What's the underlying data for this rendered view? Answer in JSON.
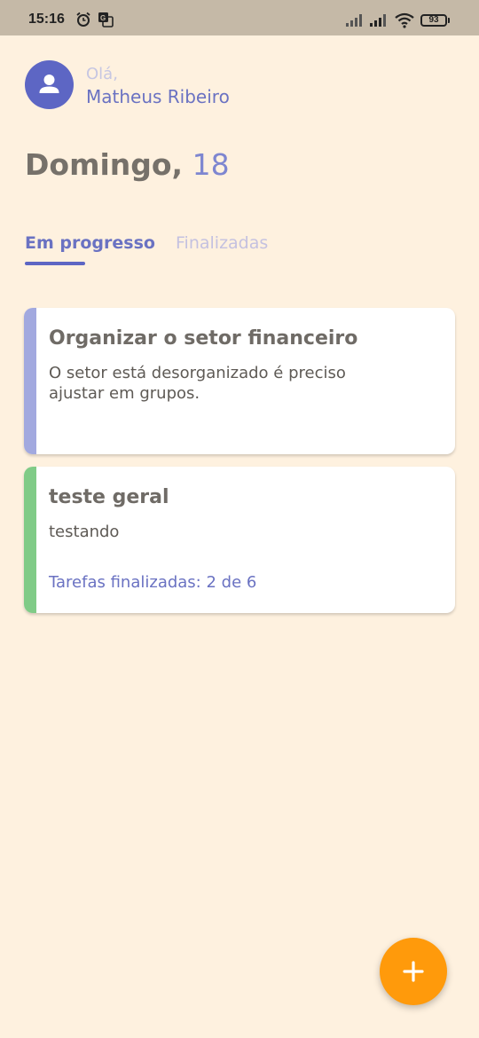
{
  "status_bar": {
    "time": "15:16",
    "battery": "93",
    "icons": [
      "alarm-icon",
      "translate-icon",
      "signal-icon",
      "signal-icon",
      "wifi-icon",
      "battery-icon"
    ]
  },
  "header": {
    "greeting": "Olá,",
    "user_name": "Matheus Ribeiro",
    "avatar_icon": "person-icon"
  },
  "date": {
    "weekday": "Domingo,",
    "day": "18"
  },
  "tabs": [
    {
      "label": "Em progresso",
      "active": true
    },
    {
      "label": "Finalizadas",
      "active": false
    }
  ],
  "cards": [
    {
      "title": "Organizar o setor financeiro",
      "description": "O setor está desorganizado é preciso ajustar em grupos.",
      "progress": "",
      "color": "#A2A9DF"
    },
    {
      "title": "teste geral",
      "description": "testando",
      "progress": "Tarefas finalizadas: 2 de 6",
      "color": "#80CB87"
    }
  ],
  "fab": {
    "icon": "plus-icon",
    "color": "#FF9A0B"
  },
  "colors": {
    "background": "#FEF1DF",
    "accent": "#5D66C4",
    "status_bar": "#C5B9A7"
  }
}
